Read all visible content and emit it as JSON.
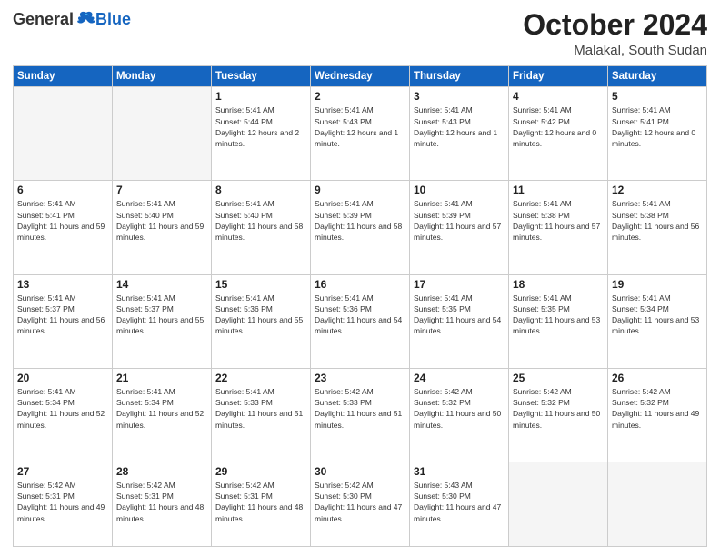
{
  "header": {
    "logo_general": "General",
    "logo_blue": "Blue",
    "month_title": "October 2024",
    "location": "Malakal, South Sudan"
  },
  "days_of_week": [
    "Sunday",
    "Monday",
    "Tuesday",
    "Wednesday",
    "Thursday",
    "Friday",
    "Saturday"
  ],
  "weeks": [
    [
      {
        "day": "",
        "sunrise": "",
        "sunset": "",
        "daylight": "",
        "empty": true
      },
      {
        "day": "",
        "sunrise": "",
        "sunset": "",
        "daylight": "",
        "empty": true
      },
      {
        "day": "1",
        "sunrise": "Sunrise: 5:41 AM",
        "sunset": "Sunset: 5:44 PM",
        "daylight": "Daylight: 12 hours and 2 minutes."
      },
      {
        "day": "2",
        "sunrise": "Sunrise: 5:41 AM",
        "sunset": "Sunset: 5:43 PM",
        "daylight": "Daylight: 12 hours and 1 minute."
      },
      {
        "day": "3",
        "sunrise": "Sunrise: 5:41 AM",
        "sunset": "Sunset: 5:43 PM",
        "daylight": "Daylight: 12 hours and 1 minute."
      },
      {
        "day": "4",
        "sunrise": "Sunrise: 5:41 AM",
        "sunset": "Sunset: 5:42 PM",
        "daylight": "Daylight: 12 hours and 0 minutes."
      },
      {
        "day": "5",
        "sunrise": "Sunrise: 5:41 AM",
        "sunset": "Sunset: 5:41 PM",
        "daylight": "Daylight: 12 hours and 0 minutes."
      }
    ],
    [
      {
        "day": "6",
        "sunrise": "Sunrise: 5:41 AM",
        "sunset": "Sunset: 5:41 PM",
        "daylight": "Daylight: 11 hours and 59 minutes."
      },
      {
        "day": "7",
        "sunrise": "Sunrise: 5:41 AM",
        "sunset": "Sunset: 5:40 PM",
        "daylight": "Daylight: 11 hours and 59 minutes."
      },
      {
        "day": "8",
        "sunrise": "Sunrise: 5:41 AM",
        "sunset": "Sunset: 5:40 PM",
        "daylight": "Daylight: 11 hours and 58 minutes."
      },
      {
        "day": "9",
        "sunrise": "Sunrise: 5:41 AM",
        "sunset": "Sunset: 5:39 PM",
        "daylight": "Daylight: 11 hours and 58 minutes."
      },
      {
        "day": "10",
        "sunrise": "Sunrise: 5:41 AM",
        "sunset": "Sunset: 5:39 PM",
        "daylight": "Daylight: 11 hours and 57 minutes."
      },
      {
        "day": "11",
        "sunrise": "Sunrise: 5:41 AM",
        "sunset": "Sunset: 5:38 PM",
        "daylight": "Daylight: 11 hours and 57 minutes."
      },
      {
        "day": "12",
        "sunrise": "Sunrise: 5:41 AM",
        "sunset": "Sunset: 5:38 PM",
        "daylight": "Daylight: 11 hours and 56 minutes."
      }
    ],
    [
      {
        "day": "13",
        "sunrise": "Sunrise: 5:41 AM",
        "sunset": "Sunset: 5:37 PM",
        "daylight": "Daylight: 11 hours and 56 minutes."
      },
      {
        "day": "14",
        "sunrise": "Sunrise: 5:41 AM",
        "sunset": "Sunset: 5:37 PM",
        "daylight": "Daylight: 11 hours and 55 minutes."
      },
      {
        "day": "15",
        "sunrise": "Sunrise: 5:41 AM",
        "sunset": "Sunset: 5:36 PM",
        "daylight": "Daylight: 11 hours and 55 minutes."
      },
      {
        "day": "16",
        "sunrise": "Sunrise: 5:41 AM",
        "sunset": "Sunset: 5:36 PM",
        "daylight": "Daylight: 11 hours and 54 minutes."
      },
      {
        "day": "17",
        "sunrise": "Sunrise: 5:41 AM",
        "sunset": "Sunset: 5:35 PM",
        "daylight": "Daylight: 11 hours and 54 minutes."
      },
      {
        "day": "18",
        "sunrise": "Sunrise: 5:41 AM",
        "sunset": "Sunset: 5:35 PM",
        "daylight": "Daylight: 11 hours and 53 minutes."
      },
      {
        "day": "19",
        "sunrise": "Sunrise: 5:41 AM",
        "sunset": "Sunset: 5:34 PM",
        "daylight": "Daylight: 11 hours and 53 minutes."
      }
    ],
    [
      {
        "day": "20",
        "sunrise": "Sunrise: 5:41 AM",
        "sunset": "Sunset: 5:34 PM",
        "daylight": "Daylight: 11 hours and 52 minutes."
      },
      {
        "day": "21",
        "sunrise": "Sunrise: 5:41 AM",
        "sunset": "Sunset: 5:34 PM",
        "daylight": "Daylight: 11 hours and 52 minutes."
      },
      {
        "day": "22",
        "sunrise": "Sunrise: 5:41 AM",
        "sunset": "Sunset: 5:33 PM",
        "daylight": "Daylight: 11 hours and 51 minutes."
      },
      {
        "day": "23",
        "sunrise": "Sunrise: 5:42 AM",
        "sunset": "Sunset: 5:33 PM",
        "daylight": "Daylight: 11 hours and 51 minutes."
      },
      {
        "day": "24",
        "sunrise": "Sunrise: 5:42 AM",
        "sunset": "Sunset: 5:32 PM",
        "daylight": "Daylight: 11 hours and 50 minutes."
      },
      {
        "day": "25",
        "sunrise": "Sunrise: 5:42 AM",
        "sunset": "Sunset: 5:32 PM",
        "daylight": "Daylight: 11 hours and 50 minutes."
      },
      {
        "day": "26",
        "sunrise": "Sunrise: 5:42 AM",
        "sunset": "Sunset: 5:32 PM",
        "daylight": "Daylight: 11 hours and 49 minutes."
      }
    ],
    [
      {
        "day": "27",
        "sunrise": "Sunrise: 5:42 AM",
        "sunset": "Sunset: 5:31 PM",
        "daylight": "Daylight: 11 hours and 49 minutes."
      },
      {
        "day": "28",
        "sunrise": "Sunrise: 5:42 AM",
        "sunset": "Sunset: 5:31 PM",
        "daylight": "Daylight: 11 hours and 48 minutes."
      },
      {
        "day": "29",
        "sunrise": "Sunrise: 5:42 AM",
        "sunset": "Sunset: 5:31 PM",
        "daylight": "Daylight: 11 hours and 48 minutes."
      },
      {
        "day": "30",
        "sunrise": "Sunrise: 5:42 AM",
        "sunset": "Sunset: 5:30 PM",
        "daylight": "Daylight: 11 hours and 47 minutes."
      },
      {
        "day": "31",
        "sunrise": "Sunrise: 5:43 AM",
        "sunset": "Sunset: 5:30 PM",
        "daylight": "Daylight: 11 hours and 47 minutes."
      },
      {
        "day": "",
        "sunrise": "",
        "sunset": "",
        "daylight": "",
        "empty": true
      },
      {
        "day": "",
        "sunrise": "",
        "sunset": "",
        "daylight": "",
        "empty": true
      }
    ]
  ]
}
